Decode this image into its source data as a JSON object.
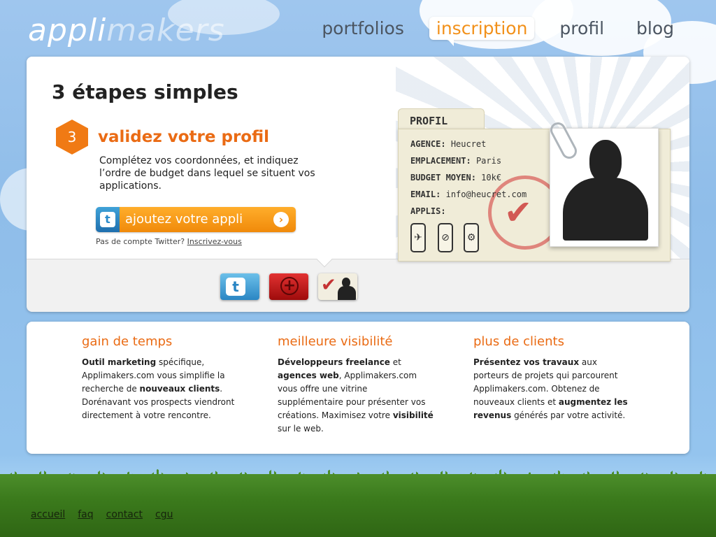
{
  "header": {
    "logo_bold": "appli",
    "logo_light": "makers",
    "nav": [
      {
        "label": "portfolios"
      },
      {
        "label": "inscription"
      },
      {
        "label": "profil"
      },
      {
        "label": "blog"
      }
    ]
  },
  "main": {
    "title": "3 étapes simples",
    "step": {
      "number": "3",
      "title": "validez votre profil",
      "text": "Complétez vos coordonnées, et indiquez l’ordre de budget dans lequel se situent vos applications."
    },
    "cta": {
      "label": "ajoutez votre appli",
      "twitter_glyph": "t",
      "arrow": "›"
    },
    "twitter_note": {
      "text": "Pas de compte Twitter?",
      "link": "Inscrivez-vous"
    },
    "card": {
      "tab": "PROFIL",
      "fields": [
        {
          "label": "AGENCE:",
          "value": "Heucret"
        },
        {
          "label": "EMPLACEMENT:",
          "value": "Paris"
        },
        {
          "label": "BUDGET MOYEN:",
          "value": "10k€"
        },
        {
          "label": "EMAIL:",
          "value": "info@heucret.com"
        },
        {
          "label": "APPLIS:",
          "value": ""
        }
      ],
      "app_icons": [
        "✈",
        "⊘",
        "⚙"
      ]
    }
  },
  "features": [
    {
      "title": "gain de temps"
    },
    {
      "title": "meilleure visibilité"
    },
    {
      "title": "plus de clients"
    }
  ],
  "footer": {
    "links": [
      "accueil",
      "faq",
      "contact",
      "cgu"
    ]
  },
  "colors": {
    "accent": "#ea6b14",
    "sky": "#8fbde9",
    "grass": "#3b7a1c"
  }
}
